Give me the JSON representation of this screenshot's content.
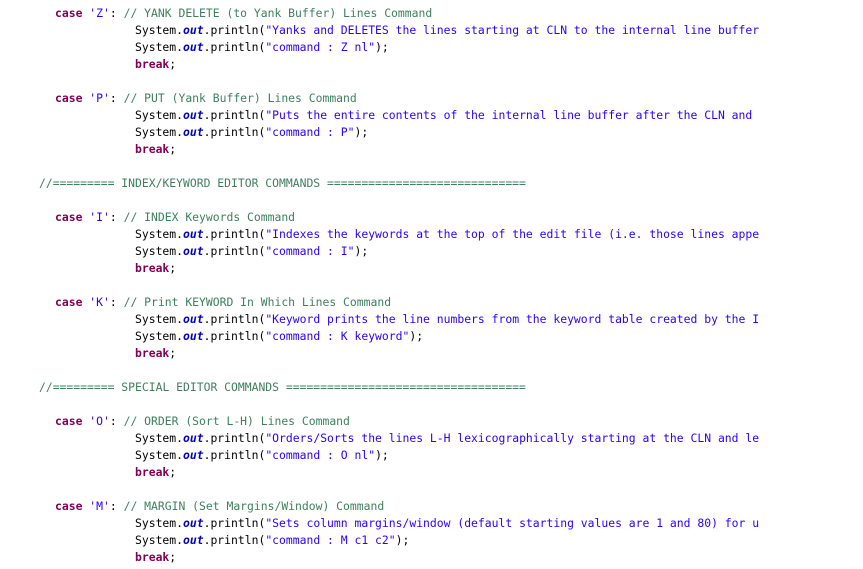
{
  "colors": {
    "keyword": "#7f0055",
    "string": "#2a00ff",
    "comment": "#3f7f5f",
    "field": "#0000c0",
    "background": "#ffffff"
  },
  "code": {
    "case_kw": "case",
    "break_kw": "break",
    "system": "System",
    "out": "out",
    "println": "println",
    "blocks": [
      {
        "char": "'Z'",
        "comment": "// YANK DELETE (to Yank Buffer) Lines Command",
        "desc": "\"Yanks and DELETES the lines starting at CLN to the internal line buffer",
        "cmd": "\"command : Z nl\""
      },
      {
        "char": "'P'",
        "comment": "// PUT (Yank Buffer) Lines Command",
        "desc": "\"Puts the entire contents of the internal line buffer after the CLN and",
        "cmd": "\"command : P\""
      },
      {
        "char": "'I'",
        "comment": "// INDEX Keywords Command",
        "desc": "\"Indexes the keywords at the top of the edit file (i.e. those lines appe",
        "cmd": "\"command : I\""
      },
      {
        "char": "'K'",
        "comment": "// Print KEYWORD In Which Lines Command",
        "desc": "\"Keyword prints the line numbers from the keyword table created by the I",
        "cmd": "\"command : K keyword\""
      },
      {
        "char": "'O'",
        "comment": "// ORDER (Sort L-H) Lines Command",
        "desc": "\"Orders/Sorts the lines L-H lexicographically starting at the CLN and le",
        "cmd": "\"command : O nl\""
      },
      {
        "char": "'M'",
        "comment": "// MARGIN (Set Margins/Window) Command",
        "desc": "\"Sets column margins/window (default starting values are 1 and 80) for u",
        "cmd": "\"command : M c1 c2\""
      }
    ],
    "sections": [
      "//========= INDEX/KEYWORD EDITOR COMMANDS =============================",
      "//========= SPECIAL EDITOR COMMANDS ==================================="
    ]
  }
}
